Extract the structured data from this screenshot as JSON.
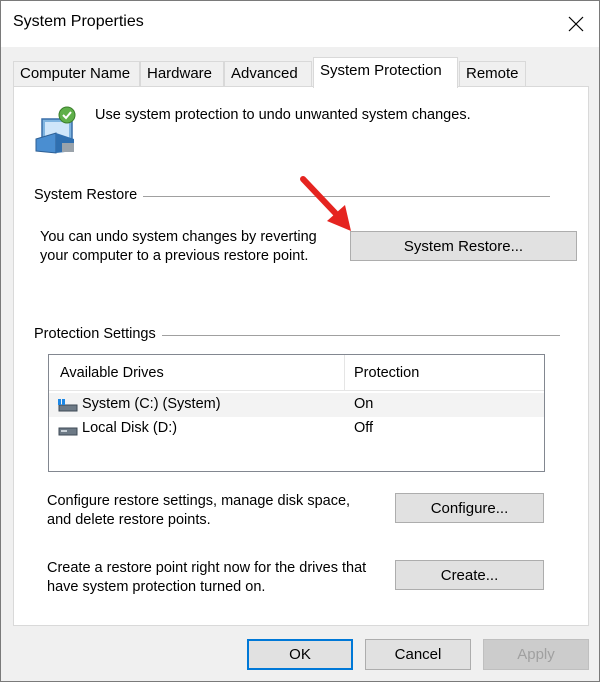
{
  "window": {
    "title": "System Properties"
  },
  "tabs": [
    {
      "label": "Computer Name"
    },
    {
      "label": "Hardware"
    },
    {
      "label": "Advanced"
    },
    {
      "label": "System Protection"
    },
    {
      "label": "Remote"
    }
  ],
  "header": {
    "text": "Use system protection to undo unwanted system changes."
  },
  "system_restore": {
    "group_label": "System Restore",
    "description_line1": "You can undo system changes by reverting",
    "description_line2": "your computer to a previous restore point.",
    "button_label": "System Restore..."
  },
  "protection_settings": {
    "group_label": "Protection Settings",
    "columns": [
      "Available Drives",
      "Protection"
    ],
    "drives": [
      {
        "name": "System (C:) (System)",
        "protection": "On",
        "icon": "system-drive-icon"
      },
      {
        "name": "Local Disk (D:)",
        "protection": "Off",
        "icon": "disk-drive-icon"
      }
    ]
  },
  "configure": {
    "description_line1": "Configure restore settings, manage disk space,",
    "description_line2": "and delete restore points.",
    "button_label": "Configure..."
  },
  "create": {
    "description_line1": "Create a restore point right now for the drives that",
    "description_line2": "have system protection turned on.",
    "button_label": "Create..."
  },
  "footer": {
    "ok_label": "OK",
    "cancel_label": "Cancel",
    "apply_label": "Apply"
  },
  "colors": {
    "accent": "#0078d7",
    "arrow": "#e52420"
  }
}
